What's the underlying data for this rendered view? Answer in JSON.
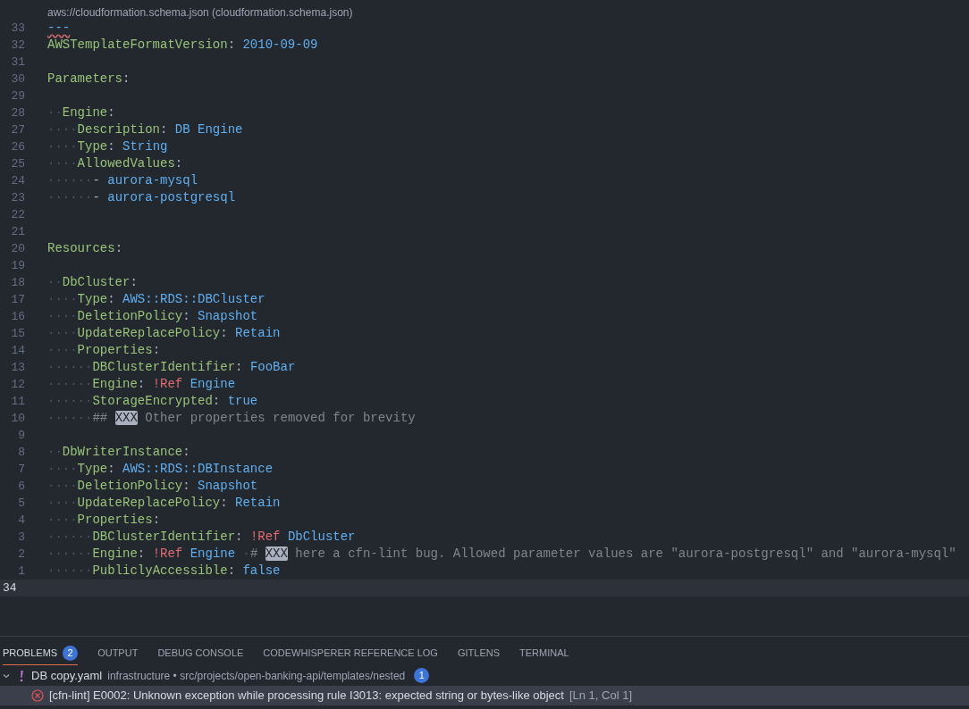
{
  "hover_source": "aws://cloudformation.schema.json (cloudformation.schema.json)",
  "lines": [
    {
      "number": "33",
      "current": false,
      "squiggly": true,
      "tokens": [
        {
          "kind": "doc",
          "t": "---"
        }
      ]
    },
    {
      "number": "32",
      "current": false,
      "squiggly": false,
      "tokens": [
        {
          "kind": "key",
          "t": "AWSTemplateFormatVersion"
        },
        {
          "kind": "punct",
          "t": ": "
        },
        {
          "kind": "value",
          "t": "2010-09-09"
        }
      ]
    },
    {
      "number": "31",
      "current": false,
      "squiggly": false
    },
    {
      "number": "30",
      "current": false,
      "squiggly": false,
      "tokens": [
        {
          "kind": "key",
          "t": "Parameters"
        },
        {
          "kind": "punct",
          "t": ":"
        }
      ]
    },
    {
      "number": "29",
      "current": false,
      "squiggly": false
    },
    {
      "number": "28",
      "current": false,
      "squiggly": false,
      "tokens": [
        {
          "kind": "ws",
          "t": "··"
        },
        {
          "kind": "key",
          "t": "Engine"
        },
        {
          "kind": "punct",
          "t": ":"
        }
      ]
    },
    {
      "number": "27",
      "current": false,
      "squiggly": false,
      "tokens": [
        {
          "kind": "ws",
          "t": "····"
        },
        {
          "kind": "key",
          "t": "Description"
        },
        {
          "kind": "punct",
          "t": ": "
        },
        {
          "kind": "value",
          "t": "DB Engine"
        }
      ]
    },
    {
      "number": "26",
      "current": false,
      "squiggly": false,
      "tokens": [
        {
          "kind": "ws",
          "t": "····"
        },
        {
          "kind": "key",
          "t": "Type"
        },
        {
          "kind": "punct",
          "t": ": "
        },
        {
          "kind": "value",
          "t": "String"
        }
      ]
    },
    {
      "number": "25",
      "current": false,
      "squiggly": false,
      "tokens": [
        {
          "kind": "ws",
          "t": "····"
        },
        {
          "kind": "key",
          "t": "AllowedValues"
        },
        {
          "kind": "punct",
          "t": ":"
        }
      ]
    },
    {
      "number": "24",
      "current": false,
      "squiggly": false,
      "tokens": [
        {
          "kind": "ws",
          "t": "······"
        },
        {
          "kind": "punct",
          "t": "- "
        },
        {
          "kind": "value",
          "t": "aurora-mysql"
        }
      ]
    },
    {
      "number": "23",
      "current": false,
      "squiggly": false,
      "tokens": [
        {
          "kind": "ws",
          "t": "······"
        },
        {
          "kind": "punct",
          "t": "- "
        },
        {
          "kind": "value",
          "t": "aurora-postgresql"
        }
      ]
    },
    {
      "number": "22",
      "current": false,
      "squiggly": false
    },
    {
      "number": "21",
      "current": false,
      "squiggly": false
    },
    {
      "number": "20",
      "current": false,
      "squiggly": false,
      "tokens": [
        {
          "kind": "key",
          "t": "Resources"
        },
        {
          "kind": "punct",
          "t": ":"
        }
      ]
    },
    {
      "number": "19",
      "current": false,
      "squiggly": false
    },
    {
      "number": "18",
      "current": false,
      "squiggly": false,
      "tokens": [
        {
          "kind": "ws",
          "t": "··"
        },
        {
          "kind": "key",
          "t": "DbCluster"
        },
        {
          "kind": "punct",
          "t": ":"
        }
      ]
    },
    {
      "number": "17",
      "current": false,
      "squiggly": false,
      "tokens": [
        {
          "kind": "ws",
          "t": "····"
        },
        {
          "kind": "key",
          "t": "Type"
        },
        {
          "kind": "punct",
          "t": ": "
        },
        {
          "kind": "value",
          "t": "AWS::RDS::DBCluster"
        }
      ]
    },
    {
      "number": "16",
      "current": false,
      "squiggly": false,
      "tokens": [
        {
          "kind": "ws",
          "t": "····"
        },
        {
          "kind": "key",
          "t": "DeletionPolicy"
        },
        {
          "kind": "punct",
          "t": ": "
        },
        {
          "kind": "value",
          "t": "Snapshot"
        }
      ]
    },
    {
      "number": "15",
      "current": false,
      "squiggly": false,
      "tokens": [
        {
          "kind": "ws",
          "t": "····"
        },
        {
          "kind": "key",
          "t": "UpdateReplacePolicy"
        },
        {
          "kind": "punct",
          "t": ": "
        },
        {
          "kind": "value",
          "t": "Retain"
        }
      ]
    },
    {
      "number": "14",
      "current": false,
      "squiggly": false,
      "tokens": [
        {
          "kind": "ws",
          "t": "····"
        },
        {
          "kind": "key",
          "t": "Properties"
        },
        {
          "kind": "punct",
          "t": ":"
        }
      ]
    },
    {
      "number": "13",
      "current": false,
      "squiggly": false,
      "tokens": [
        {
          "kind": "ws",
          "t": "······"
        },
        {
          "kind": "key",
          "t": "DBClusterIdentifier"
        },
        {
          "kind": "punct",
          "t": ": "
        },
        {
          "kind": "value",
          "t": "FooBar"
        }
      ]
    },
    {
      "number": "12",
      "current": false,
      "squiggly": false,
      "tokens": [
        {
          "kind": "ws",
          "t": "······"
        },
        {
          "kind": "key",
          "t": "Engine"
        },
        {
          "kind": "punct",
          "t": ": "
        },
        {
          "kind": "tag",
          "t": "!Ref "
        },
        {
          "kind": "value",
          "t": "Engine"
        }
      ]
    },
    {
      "number": "11",
      "current": false,
      "squiggly": false,
      "tokens": [
        {
          "kind": "ws",
          "t": "······"
        },
        {
          "kind": "key",
          "t": "StorageEncrypted"
        },
        {
          "kind": "punct",
          "t": ": "
        },
        {
          "kind": "value",
          "t": "true"
        }
      ]
    },
    {
      "number": "10",
      "current": false,
      "squiggly": false,
      "tokens": [
        {
          "kind": "ws",
          "t": "······"
        },
        {
          "kind": "comment",
          "t": "## "
        },
        {
          "kind": "mark",
          "t": "XXX"
        },
        {
          "kind": "comment",
          "t": " Other properties removed for brevity"
        }
      ]
    },
    {
      "number": "9",
      "current": false,
      "squiggly": false
    },
    {
      "number": "8",
      "current": false,
      "squiggly": false,
      "tokens": [
        {
          "kind": "ws",
          "t": "··"
        },
        {
          "kind": "key",
          "t": "DbWriterInstance"
        },
        {
          "kind": "punct",
          "t": ":"
        }
      ]
    },
    {
      "number": "7",
      "current": false,
      "squiggly": false,
      "tokens": [
        {
          "kind": "ws",
          "t": "····"
        },
        {
          "kind": "key",
          "t": "Type"
        },
        {
          "kind": "punct",
          "t": ": "
        },
        {
          "kind": "value",
          "t": "AWS::RDS::DBInstance"
        }
      ]
    },
    {
      "number": "6",
      "current": false,
      "squiggly": false,
      "tokens": [
        {
          "kind": "ws",
          "t": "····"
        },
        {
          "kind": "key",
          "t": "DeletionPolicy"
        },
        {
          "kind": "punct",
          "t": ": "
        },
        {
          "kind": "value",
          "t": "Snapshot"
        }
      ]
    },
    {
      "number": "5",
      "current": false,
      "squiggly": false,
      "tokens": [
        {
          "kind": "ws",
          "t": "····"
        },
        {
          "kind": "key",
          "t": "UpdateReplacePolicy"
        },
        {
          "kind": "punct",
          "t": ": "
        },
        {
          "kind": "value",
          "t": "Retain"
        }
      ]
    },
    {
      "number": "4",
      "current": false,
      "squiggly": false,
      "tokens": [
        {
          "kind": "ws",
          "t": "····"
        },
        {
          "kind": "key",
          "t": "Properties"
        },
        {
          "kind": "punct",
          "t": ":"
        }
      ]
    },
    {
      "number": "3",
      "current": false,
      "squiggly": false,
      "tokens": [
        {
          "kind": "ws",
          "t": "······"
        },
        {
          "kind": "key",
          "t": "DBClusterIdentifier"
        },
        {
          "kind": "punct",
          "t": ": "
        },
        {
          "kind": "tag",
          "t": "!Ref "
        },
        {
          "kind": "value",
          "t": "DbCluster"
        }
      ]
    },
    {
      "number": "2",
      "current": false,
      "squiggly": false,
      "tokens": [
        {
          "kind": "ws",
          "t": "······"
        },
        {
          "kind": "key",
          "t": "Engine"
        },
        {
          "kind": "punct",
          "t": ": "
        },
        {
          "kind": "tag",
          "t": "!Ref "
        },
        {
          "kind": "value",
          "t": "Engine"
        },
        {
          "kind": "ws",
          "t": " ·"
        },
        {
          "kind": "comment",
          "t": "# "
        },
        {
          "kind": "mark",
          "t": "XXX"
        },
        {
          "kind": "comment",
          "t": " here a cfn-lint bug. Allowed parameter values are \"aurora-postgresql\" and \"aurora-mysql\""
        }
      ]
    },
    {
      "number": "1",
      "current": false,
      "squiggly": false,
      "tokens": [
        {
          "kind": "ws",
          "t": "······"
        },
        {
          "kind": "key",
          "t": "PubliclyAccessible"
        },
        {
          "kind": "punct",
          "t": ": "
        },
        {
          "kind": "value",
          "t": "false"
        }
      ]
    },
    {
      "number": "34",
      "current": true,
      "squiggly": false
    }
  ],
  "panel": {
    "tabs": [
      {
        "label": "PROBLEMS",
        "badge": "2",
        "selected": true
      },
      {
        "label": "OUTPUT",
        "selected": false
      },
      {
        "label": "DEBUG CONSOLE",
        "selected": false
      },
      {
        "label": "CODEWHISPERER REFERENCE LOG",
        "selected": false
      },
      {
        "label": "GITLENS",
        "selected": false
      },
      {
        "label": "TERMINAL",
        "selected": false
      }
    ],
    "file": {
      "expanded": true,
      "name": "DB copy.yaml",
      "path": "infrastructure • src/projects/open-banking-api/templates/nested",
      "count": "1"
    },
    "problems": [
      {
        "message": "[cfn-lint] E0002: Unknown exception while processing rule I3013: expected string or bytes-like object",
        "location": "[Ln 1, Col 1]",
        "selected": true
      }
    ]
  }
}
